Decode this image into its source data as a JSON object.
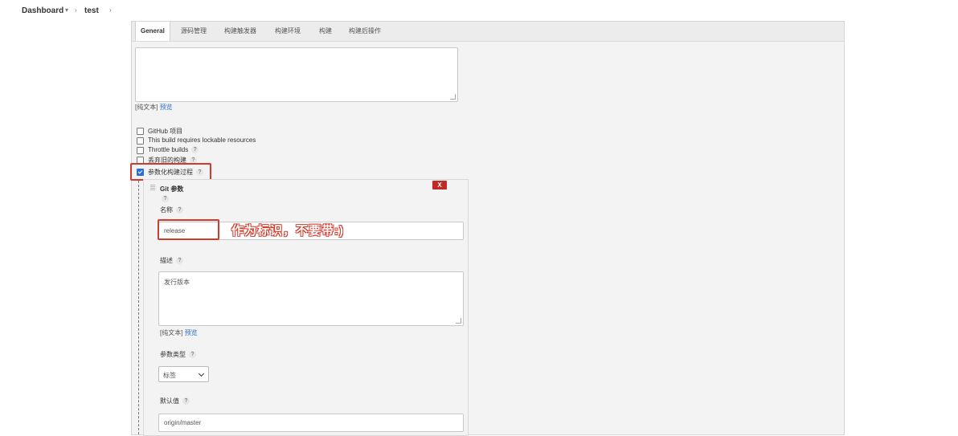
{
  "breadcrumb": {
    "dashboard": "Dashboard",
    "project": "test"
  },
  "tabs": [
    "General",
    "源码管理",
    "构建触发器",
    "构建环境",
    "构建",
    "构建后操作"
  ],
  "description": {
    "plain_text": "[纯文本]",
    "preview": "预览"
  },
  "options": [
    {
      "label": "GitHub 项目",
      "checked": false,
      "help": false
    },
    {
      "label": "This build requires lockable resources",
      "checked": false,
      "help": false
    },
    {
      "label": "Throttle builds",
      "checked": false,
      "help": true
    },
    {
      "label": "丢弃旧的构建",
      "checked": false,
      "help": true
    },
    {
      "label": "参数化构建过程",
      "checked": true,
      "help": true
    }
  ],
  "help_mark": "?",
  "git_param": {
    "title": "Git 参数",
    "delete_label": "X",
    "name_label": "名称",
    "name_value": "release",
    "annotation": "作为标识，不要带:)",
    "desc_label": "描述",
    "desc_value": "发行版本",
    "plain_text": "[纯文本]",
    "preview": "预览",
    "type_label": "参数类型",
    "type_value": "标签",
    "default_label": "默认值",
    "default_value": "origin/master"
  }
}
